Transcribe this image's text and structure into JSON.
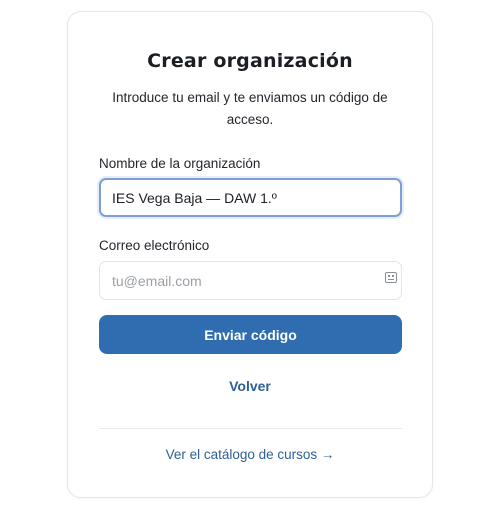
{
  "form": {
    "title": "Crear organización",
    "subtitle": "Introduce tu email y te enviamos un código de acceso.",
    "org_label": "Nombre de la organización",
    "org_value": "IES Vega Baja — DAW 1.º",
    "email_label": "Correo electrónico",
    "email_value": "",
    "email_placeholder": "tu@email.com",
    "email_field_icon": "keyboard-icon",
    "submit_label": "Enviar código",
    "back_label": "Volver",
    "catalog_label": "Ver el catálogo de cursos →"
  },
  "colors": {
    "primary": "#2f6db0",
    "link": "#2f5f97",
    "focus_border": "#7e9fd3"
  }
}
